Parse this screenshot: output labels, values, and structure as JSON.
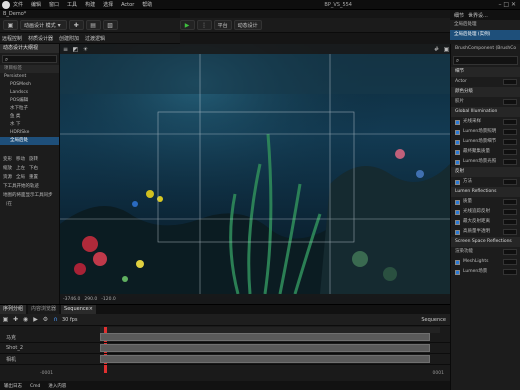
{
  "menubar": {
    "items": [
      "文件",
      "编辑",
      "窗口",
      "工具",
      "构建",
      "选择",
      "Actor",
      "帮助"
    ],
    "project": "BP_VS_554"
  },
  "window_title": "B_Demo*",
  "toolbar1": {
    "save_label": "保存",
    "mode_label": "动画设计 模式",
    "platform_label": "平台",
    "build_label": "动态设计"
  },
  "toolbar2": {
    "items": [
      "远程控制",
      "材质设计器",
      "创建附加",
      "过渡逻辑"
    ]
  },
  "outliner": {
    "tab": "动态设计大纲视",
    "header": "项目标签",
    "rows": [
      {
        "label": "Persistent",
        "sel": false
      },
      {
        "label": "POSMesh",
        "sel": false
      },
      {
        "label": "Landscs",
        "sel": false
      },
      {
        "label": "POS编辑",
        "sel": false
      },
      {
        "label": "水下粒子",
        "sel": false
      },
      {
        "label": "鱼 类",
        "sel": false
      },
      {
        "label": "水 下",
        "sel": false
      },
      {
        "label": "HDRISke",
        "sel": false
      },
      {
        "label": "全局后处",
        "sel": true
      }
    ],
    "details": [
      [
        "变形",
        "移动",
        "旋转"
      ],
      [
        "缩放",
        "上左",
        "下右"
      ],
      [
        "资源",
        "全局",
        "重置"
      ],
      [
        "下工具开始的轨迹"
      ],
      [
        "地图的将面显示工具同步（在"
      ]
    ]
  },
  "viewport": {
    "status": [
      "-3746.0",
      "290.0",
      "-120.0"
    ]
  },
  "sequencer": {
    "tabs": [
      "序列分组",
      "内容浏览器",
      "Sequence×"
    ],
    "fps": "30 fps",
    "sequence_name": "Sequence",
    "tracks": [
      "马克",
      "Shot_2",
      "相机"
    ],
    "frame_start": "-0001",
    "frame_end": "0001",
    "bottom": [
      "输出日志",
      "Cmd",
      "进入内容"
    ]
  },
  "right_panel": {
    "tabs": [
      "细节",
      "世界设..."
    ],
    "component": "全局后处理",
    "component_full": "全局后处理 (实例)",
    "brush": "BrushComponent (BrushCo",
    "sections": [
      {
        "type": "sec",
        "label": "细节"
      },
      {
        "type": "row",
        "label": "Actor"
      },
      {
        "type": "sec",
        "label": "颜色分级"
      },
      {
        "type": "row",
        "label": "胶片"
      },
      {
        "type": "sec",
        "label": "Global Illumination"
      },
      {
        "type": "chk",
        "label": "光线采样"
      },
      {
        "type": "chk",
        "label": "Lumen场景照明"
      },
      {
        "type": "chk",
        "label": "Lumen场景细节"
      },
      {
        "type": "chk",
        "label": "最终聚集质量"
      },
      {
        "type": "chk",
        "label": "Lumen场景光照"
      },
      {
        "type": "sec",
        "label": "反射"
      },
      {
        "type": "chk",
        "label": "方法"
      },
      {
        "type": "sec",
        "label": "Lumen Reflections"
      },
      {
        "type": "chk",
        "label": "质量"
      },
      {
        "type": "chk",
        "label": "光线追踪反射"
      },
      {
        "type": "chk",
        "label": "最大反射距离"
      },
      {
        "type": "chk",
        "label": "高质量半透明"
      },
      {
        "type": "sec",
        "label": "Screen Space Reflections"
      },
      {
        "type": "row",
        "label": "渲染功能"
      },
      {
        "type": "chk",
        "label": "MeshLights"
      },
      {
        "type": "chk",
        "label": "Lumen场景"
      }
    ]
  }
}
